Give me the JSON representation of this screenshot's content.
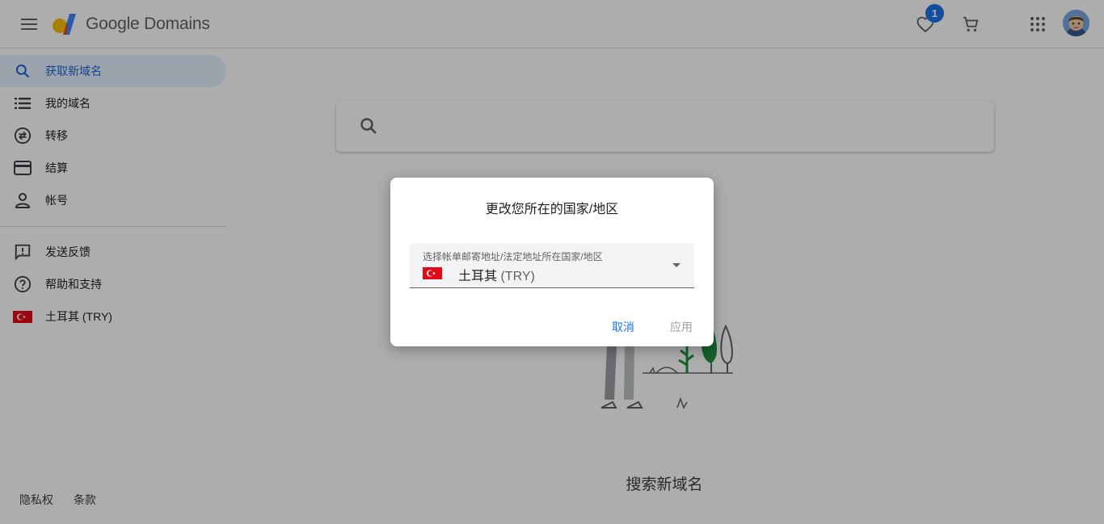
{
  "app": {
    "brand": "Google Domains",
    "favorites_count": "1"
  },
  "nav": {
    "items": [
      {
        "label": "获取新域名",
        "icon": "search-icon",
        "active": true
      },
      {
        "label": "我的域名",
        "icon": "list-icon"
      },
      {
        "label": "转移",
        "icon": "transfer-icon"
      },
      {
        "label": "结算",
        "icon": "credit-card-icon"
      },
      {
        "label": "帐号",
        "icon": "person-icon"
      }
    ],
    "secondary": [
      {
        "label": "发送反馈",
        "icon": "feedback-icon"
      },
      {
        "label": "帮助和支持",
        "icon": "help-icon"
      },
      {
        "label": "土耳其 (TRY)",
        "icon": "turkey-flag-icon"
      }
    ],
    "footer": {
      "privacy": "隐私权",
      "terms": "条款"
    }
  },
  "main": {
    "search_placeholder": "",
    "empty_title": "搜索新域名"
  },
  "dialog": {
    "title": "更改您所在的国家/地区",
    "field_label": "选择帐单邮寄地址/法定地址所在国家/地区",
    "country_name": "土耳其",
    "currency": "(TRY)",
    "cancel": "取消",
    "apply": "应用"
  },
  "colors": {
    "accent": "#1a73e8",
    "active_bg": "#e8f0fe",
    "flag_red": "#e30a17"
  }
}
